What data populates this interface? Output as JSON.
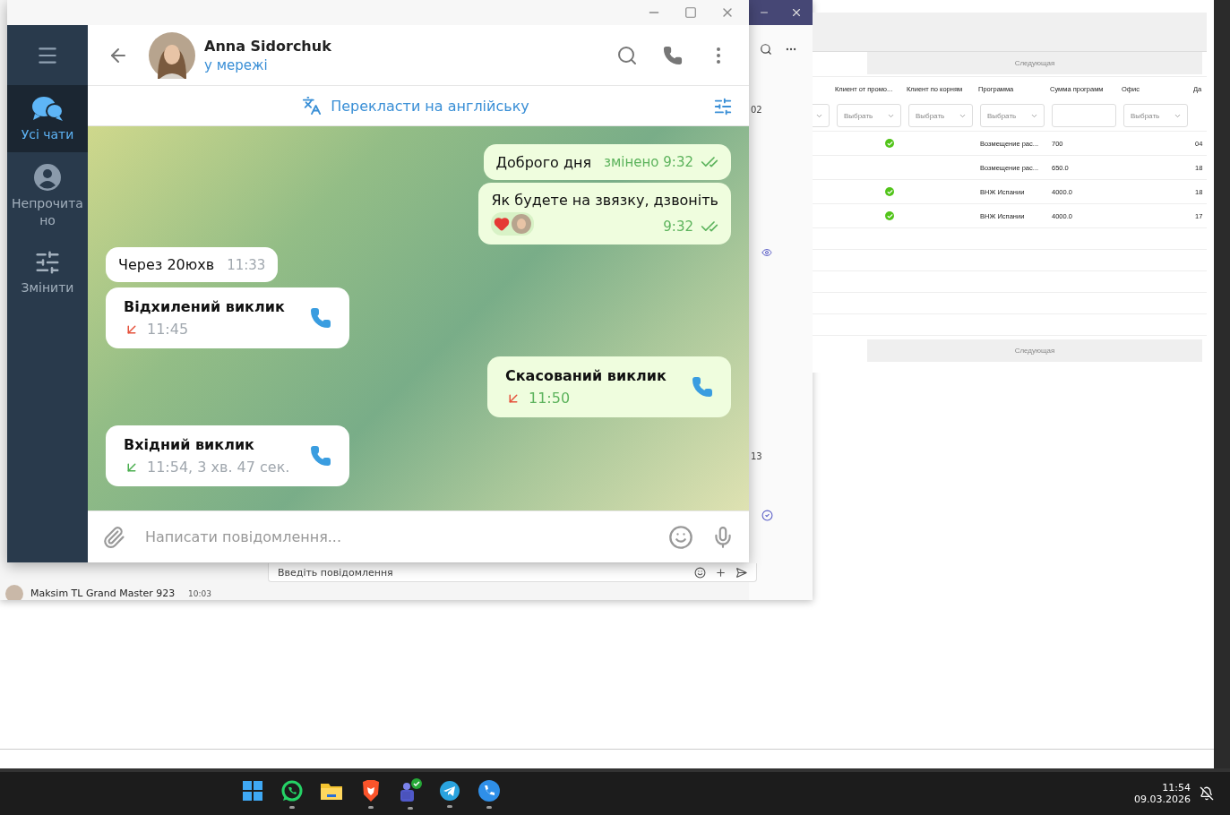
{
  "telegram": {
    "sidebar": [
      {
        "kind": "chats",
        "label": "Усі чати",
        "selected": true
      },
      {
        "kind": "unread",
        "label": "Непрочитано",
        "selected": false
      },
      {
        "kind": "edit",
        "label": "Змінити",
        "selected": false
      }
    ],
    "header": {
      "name": "Anna Sidorchuk",
      "status": "у мережі"
    },
    "translate": "Перекласти на англійську",
    "messages": [
      {
        "kind": "text",
        "outgoing": true,
        "text": "Доброго дня",
        "time": "змінено 9:32",
        "read": true
      },
      {
        "kind": "text",
        "outgoing": true,
        "text": "Як будете на звязку, дзвоніть",
        "time": "9:32",
        "read": true,
        "reaction": true
      },
      {
        "kind": "text",
        "outgoing": false,
        "text": "Через 20юхв",
        "time": "11:33"
      },
      {
        "kind": "call",
        "outgoing": false,
        "text": "Відхилений виклик",
        "time": "11:45",
        "missed": true
      },
      {
        "kind": "call",
        "outgoing": true,
        "text": "Скасований виклик",
        "time": "11:50",
        "missed": true
      },
      {
        "kind": "call",
        "outgoing": false,
        "text": "Вхідний виклик",
        "time": "11:54, 3 хв. 47 сек.",
        "missed": false
      }
    ],
    "input": {
      "placeholder": "Написати повідомлення..."
    }
  },
  "teams": {
    "dates": [
      "02",
      "13"
    ],
    "chat_row": {
      "name": "Maksim TL Grand Master 923",
      "time": "10:03"
    },
    "compose": {
      "placeholder": "Введіть повідомлення"
    }
  },
  "web": {
    "next_buttons": [
      "Следующая",
      "Следующая"
    ],
    "columns": [
      "Клиент от промо...",
      "Клиент по корням",
      "Программа",
      "Сумма программ",
      "Офис",
      "Да"
    ],
    "filters": [
      {
        "kind": "select",
        "label": "Выбрать"
      },
      {
        "kind": "select",
        "label": "Выбрать"
      },
      {
        "kind": "select",
        "label": "Выбрать"
      },
      {
        "kind": "input"
      },
      {
        "kind": "select",
        "label": "Выбрать"
      }
    ],
    "rows": [
      {
        "promo": true,
        "program": "Возмещение рас...",
        "sum": "700",
        "date": "04"
      },
      {
        "promo": false,
        "program": "Возмещение рас...",
        "sum": "650.0",
        "date": "18"
      },
      {
        "promo": true,
        "program": "ВНЖ Испании",
        "sum": "4000.0",
        "date": "18"
      },
      {
        "promo": true,
        "program": "ВНЖ Испании",
        "sum": "4000.0",
        "date": "17"
      }
    ]
  },
  "taskbar": {
    "apps": [
      {
        "kind": "start",
        "running": false
      },
      {
        "kind": "whatsapp",
        "running": true
      },
      {
        "kind": "files",
        "running": false
      },
      {
        "kind": "brave",
        "running": true
      },
      {
        "kind": "teams",
        "running": true
      },
      {
        "kind": "telegram",
        "running": true
      },
      {
        "kind": "phone",
        "running": true
      }
    ],
    "time": "11:54",
    "date": "09.03.2026"
  }
}
